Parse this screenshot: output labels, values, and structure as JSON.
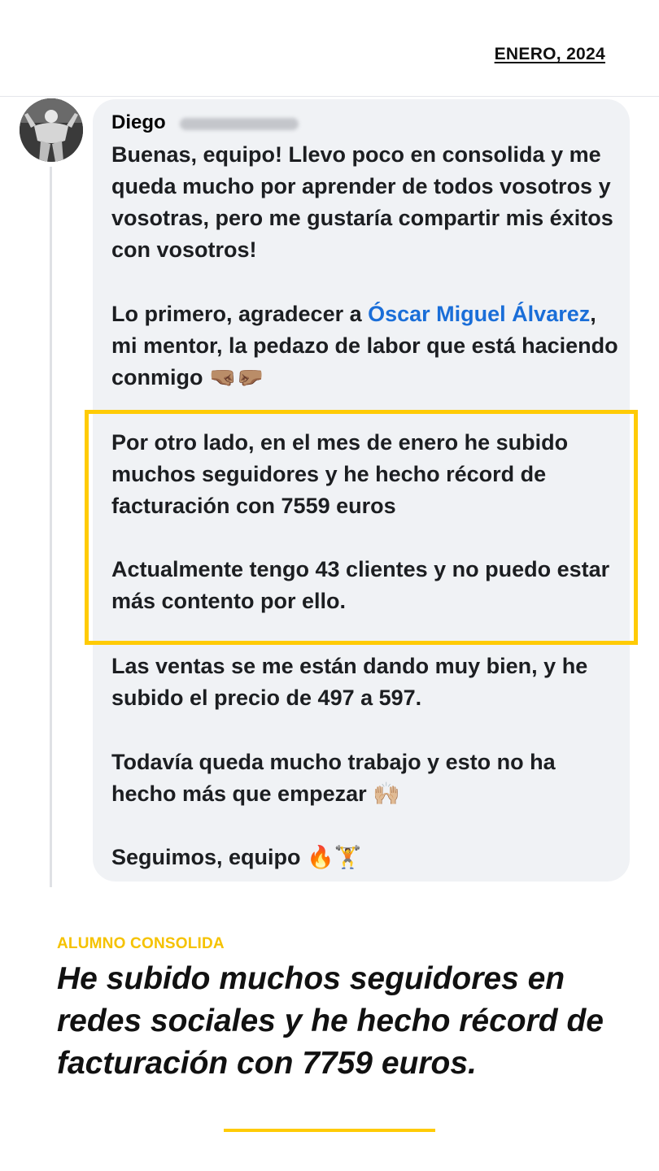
{
  "header": {
    "date": "ENERO, 2024"
  },
  "post": {
    "author": "Diego",
    "paragraphs": [
      "Buenas, equipo! Llevo poco en consolida y me queda mucho por aprender de todos vosotros y vosotras, pero me gustaría compartir mis éxitos con vosotros!",
      "Por otro lado, en el mes de enero he subido muchos seguidores y he hecho récord de facturación con 7559 euros",
      "Actualmente tengo 43 clientes y no puedo estar más contento por ello.",
      "Las ventas se me están dando muy bien, y he subido el precio de 497 a 597.",
      "Todavía queda mucho trabajo y esto no ha hecho más que empezar 🙌🏼",
      "Seguimos, equipo 🔥🏋️"
    ],
    "thanks": {
      "before": "Lo primero, agradecer a ",
      "mention": "Óscar Miguel Álvarez",
      "after": ", mi mentor, la pedazo de labor que está haciendo conmigo",
      "emoji": "🤜🏽🤛🏽"
    }
  },
  "caption": {
    "kicker": "ALUMNO CONSOLIDA",
    "headline": "He subido muchos seguidores en redes sociales y he hecho récord de facturación con 7759 euros."
  },
  "colors": {
    "accent": "#ffcb05",
    "mention": "#1a6ed8",
    "bubble": "#f0f2f5"
  }
}
